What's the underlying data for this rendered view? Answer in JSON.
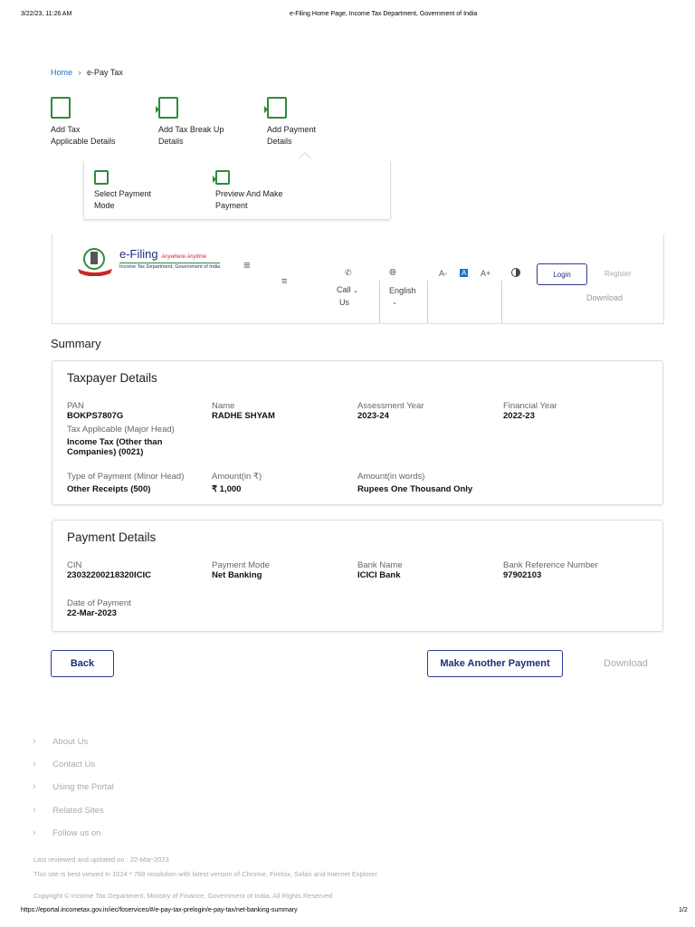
{
  "print_header": {
    "datetime": "3/22/23, 11:26 AM",
    "title": "e-Filing Home Page, Income Tax Department, Government of India"
  },
  "breadcrumb": {
    "home": "Home",
    "separator": "›",
    "current": "e-Pay Tax"
  },
  "steps": [
    {
      "line1": "Add Tax",
      "line2": "Applicable Details"
    },
    {
      "line1": "Add Tax Break Up",
      "line2": "Details"
    },
    {
      "line1": "Add Payment",
      "line2": "Details"
    }
  ],
  "substeps": [
    {
      "line1": "Select Payment",
      "line2": "Mode"
    },
    {
      "line1": "Preview And Make",
      "line2": "Payment"
    }
  ],
  "navbar": {
    "logo_title": "e-Filing",
    "logo_tagline": "Anywhere Anytime",
    "logo_subtitle": "Income Tax Department, Government of India",
    "call_line1": "Call",
    "call_line2": "Us",
    "language": "English",
    "font_decrease": "A-",
    "font_normal": "A",
    "font_increase": "A+",
    "login": "Login",
    "register": "Register",
    "download": "Download"
  },
  "summary_title": "Summary",
  "taxpayer": {
    "title": "Taxpayer Details",
    "pan_label": "PAN",
    "pan": "BOKPS7807G",
    "name_label": "Name",
    "name": "RADHE SHYAM",
    "ay_label": "Assessment Year",
    "ay": "2023-24",
    "fy_label": "Financial Year",
    "fy": "2022-23",
    "major_label": "Tax Applicable (Major Head)",
    "major": "Income Tax (Other than Companies) (0021)",
    "minor_label": "Type of Payment (Minor Head)",
    "minor": "Other Receipts (500)",
    "amount_label": "Amount(in ₹)",
    "amount": "₹ 1,000",
    "words_label": "Amount(in words)",
    "words": "Rupees One Thousand Only"
  },
  "payment": {
    "title": "Payment Details",
    "cin_label": "CIN",
    "cin": "23032200218320ICIC",
    "mode_label": "Payment Mode",
    "mode": "Net Banking",
    "bank_label": "Bank Name",
    "bank": "ICICI Bank",
    "ref_label": "Bank Reference Number",
    "ref": "97902103",
    "date_label": "Date of Payment",
    "date": "22-Mar-2023"
  },
  "actions": {
    "back": "Back",
    "another": "Make Another Payment",
    "download": "Download"
  },
  "footer_links": [
    "About Us",
    "Contact Us",
    "Using the Portal",
    "Related Sites",
    "Follow us on"
  ],
  "footer_notes": {
    "reviewed": "Last reviewed and updated on : 22-Mar-2023",
    "best_viewed": "This site is best viewed in 1024 * 768 resolution with latest version of Chrome, Firefox, Safari and Internet Explorer.",
    "copyright": "Copyright © Income Tax Department, Ministry of Finance, Government of India. All Rights Reserved"
  },
  "print_footer": {
    "url": "https://eportal.incometax.gov.in/iec/foservices/#/e-pay-tax-prelogin/e-pay-tax/net-banking-summary",
    "page": "1/2"
  },
  "colors": {
    "accent": "#1f2d7a",
    "step_green": "#2e8b3a",
    "link": "#1a73c8"
  }
}
